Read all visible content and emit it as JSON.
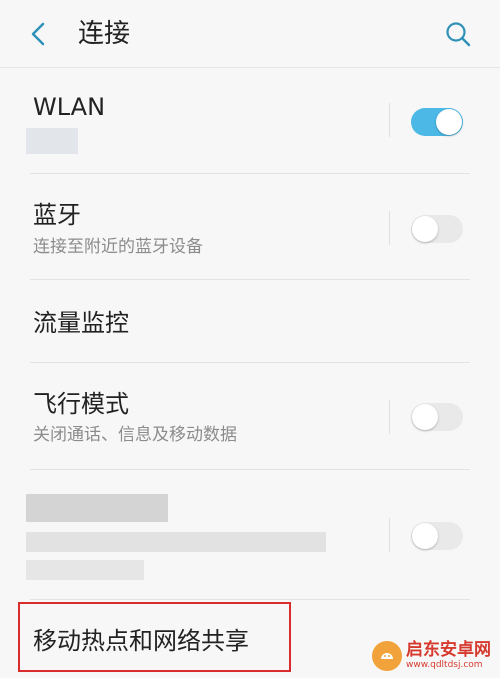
{
  "header": {
    "title": "连接",
    "back_icon": "chevron-left-icon",
    "search_icon": "search-icon"
  },
  "rows": {
    "wlan": {
      "title": "WLAN",
      "toggle": "on"
    },
    "bluetooth": {
      "title": "蓝牙",
      "subtitle": "连接至附近的蓝牙设备",
      "toggle": "off"
    },
    "data_monitor": {
      "title": "流量监控"
    },
    "airplane": {
      "title": "飞行模式",
      "subtitle": "关闭通话、信息及移动数据",
      "toggle": "off"
    },
    "hidden_item": {
      "toggle": "off"
    },
    "hotspot": {
      "title": "移动热点和网络共享"
    }
  },
  "watermark": {
    "title": "启东安卓网",
    "url": "www.qdltdsj.com"
  },
  "colors": {
    "accent": "#4bb8e6",
    "highlight": "#d92d2d",
    "background": "#f7f7f7"
  }
}
